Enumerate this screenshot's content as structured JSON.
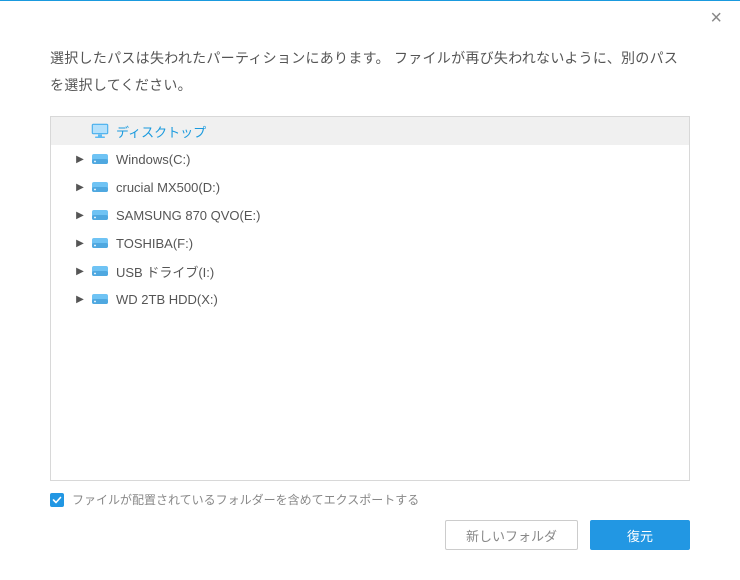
{
  "message": "選択したパスは失われたパーティションにあります。 ファイルが再び失われないように、別のパスを選択してください。",
  "tree": {
    "items": [
      {
        "label": "ディスクトップ",
        "icon": "monitor",
        "expandable": false,
        "selected": true
      },
      {
        "label": "Windows(C:)",
        "icon": "hdd",
        "expandable": true,
        "selected": false
      },
      {
        "label": "crucial MX500(D:)",
        "icon": "hdd",
        "expandable": true,
        "selected": false
      },
      {
        "label": "SAMSUNG 870 QVO(E:)",
        "icon": "hdd",
        "expandable": true,
        "selected": false
      },
      {
        "label": "TOSHIBA(F:)",
        "icon": "hdd",
        "expandable": true,
        "selected": false
      },
      {
        "label": "USB ドライブ(I:)",
        "icon": "hdd",
        "expandable": true,
        "selected": false
      },
      {
        "label": "WD 2TB HDD(X:)",
        "icon": "hdd",
        "expandable": true,
        "selected": false
      }
    ]
  },
  "checkbox": {
    "checked": true,
    "label": "ファイルが配置されているフォルダーを含めてエクスポートする"
  },
  "buttons": {
    "new_folder": "新しいフォルダ",
    "restore": "復元"
  }
}
